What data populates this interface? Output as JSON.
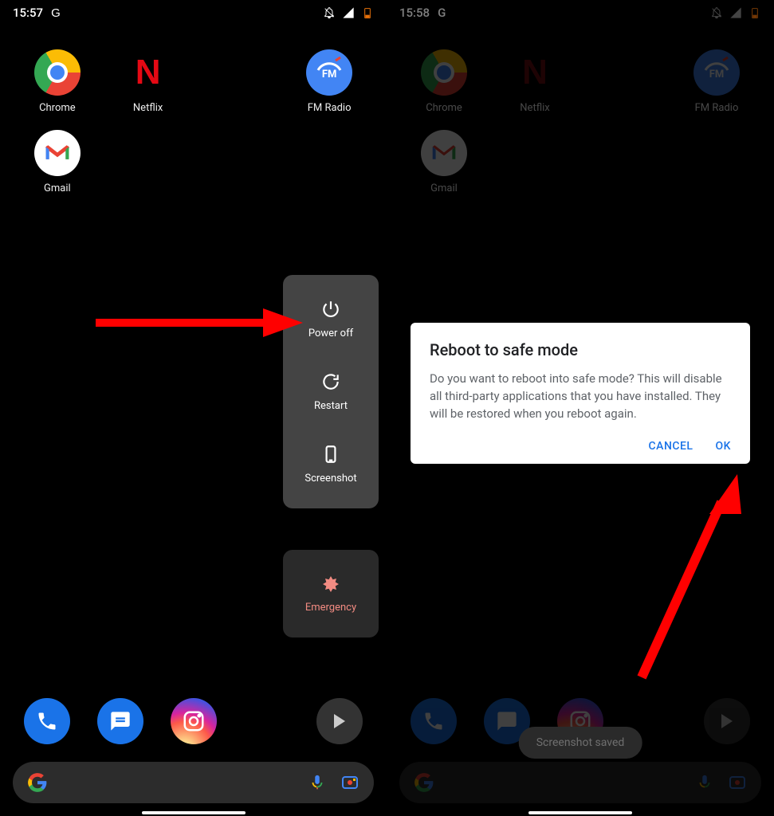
{
  "left": {
    "time": "15:57",
    "g_indicator": "G",
    "apps": {
      "chrome": "Chrome",
      "netflix": "Netflix",
      "fmradio": "FM Radio",
      "gmail": "Gmail"
    },
    "power_menu": {
      "power_off": "Power off",
      "restart": "Restart",
      "screenshot": "Screenshot",
      "emergency": "Emergency"
    }
  },
  "right": {
    "time": "15:58",
    "g_indicator": "G",
    "apps": {
      "chrome": "Chrome",
      "netflix": "Netflix",
      "fmradio": "FM Radio",
      "gmail": "Gmail"
    },
    "dialog": {
      "title": "Reboot to safe mode",
      "body": "Do you want to reboot into safe mode? This will disable all third-party applications that you have installed. They will be restored when you reboot again.",
      "cancel": "CANCEL",
      "ok": "OK"
    },
    "toast": "Screenshot saved"
  },
  "fm_text": "FM"
}
